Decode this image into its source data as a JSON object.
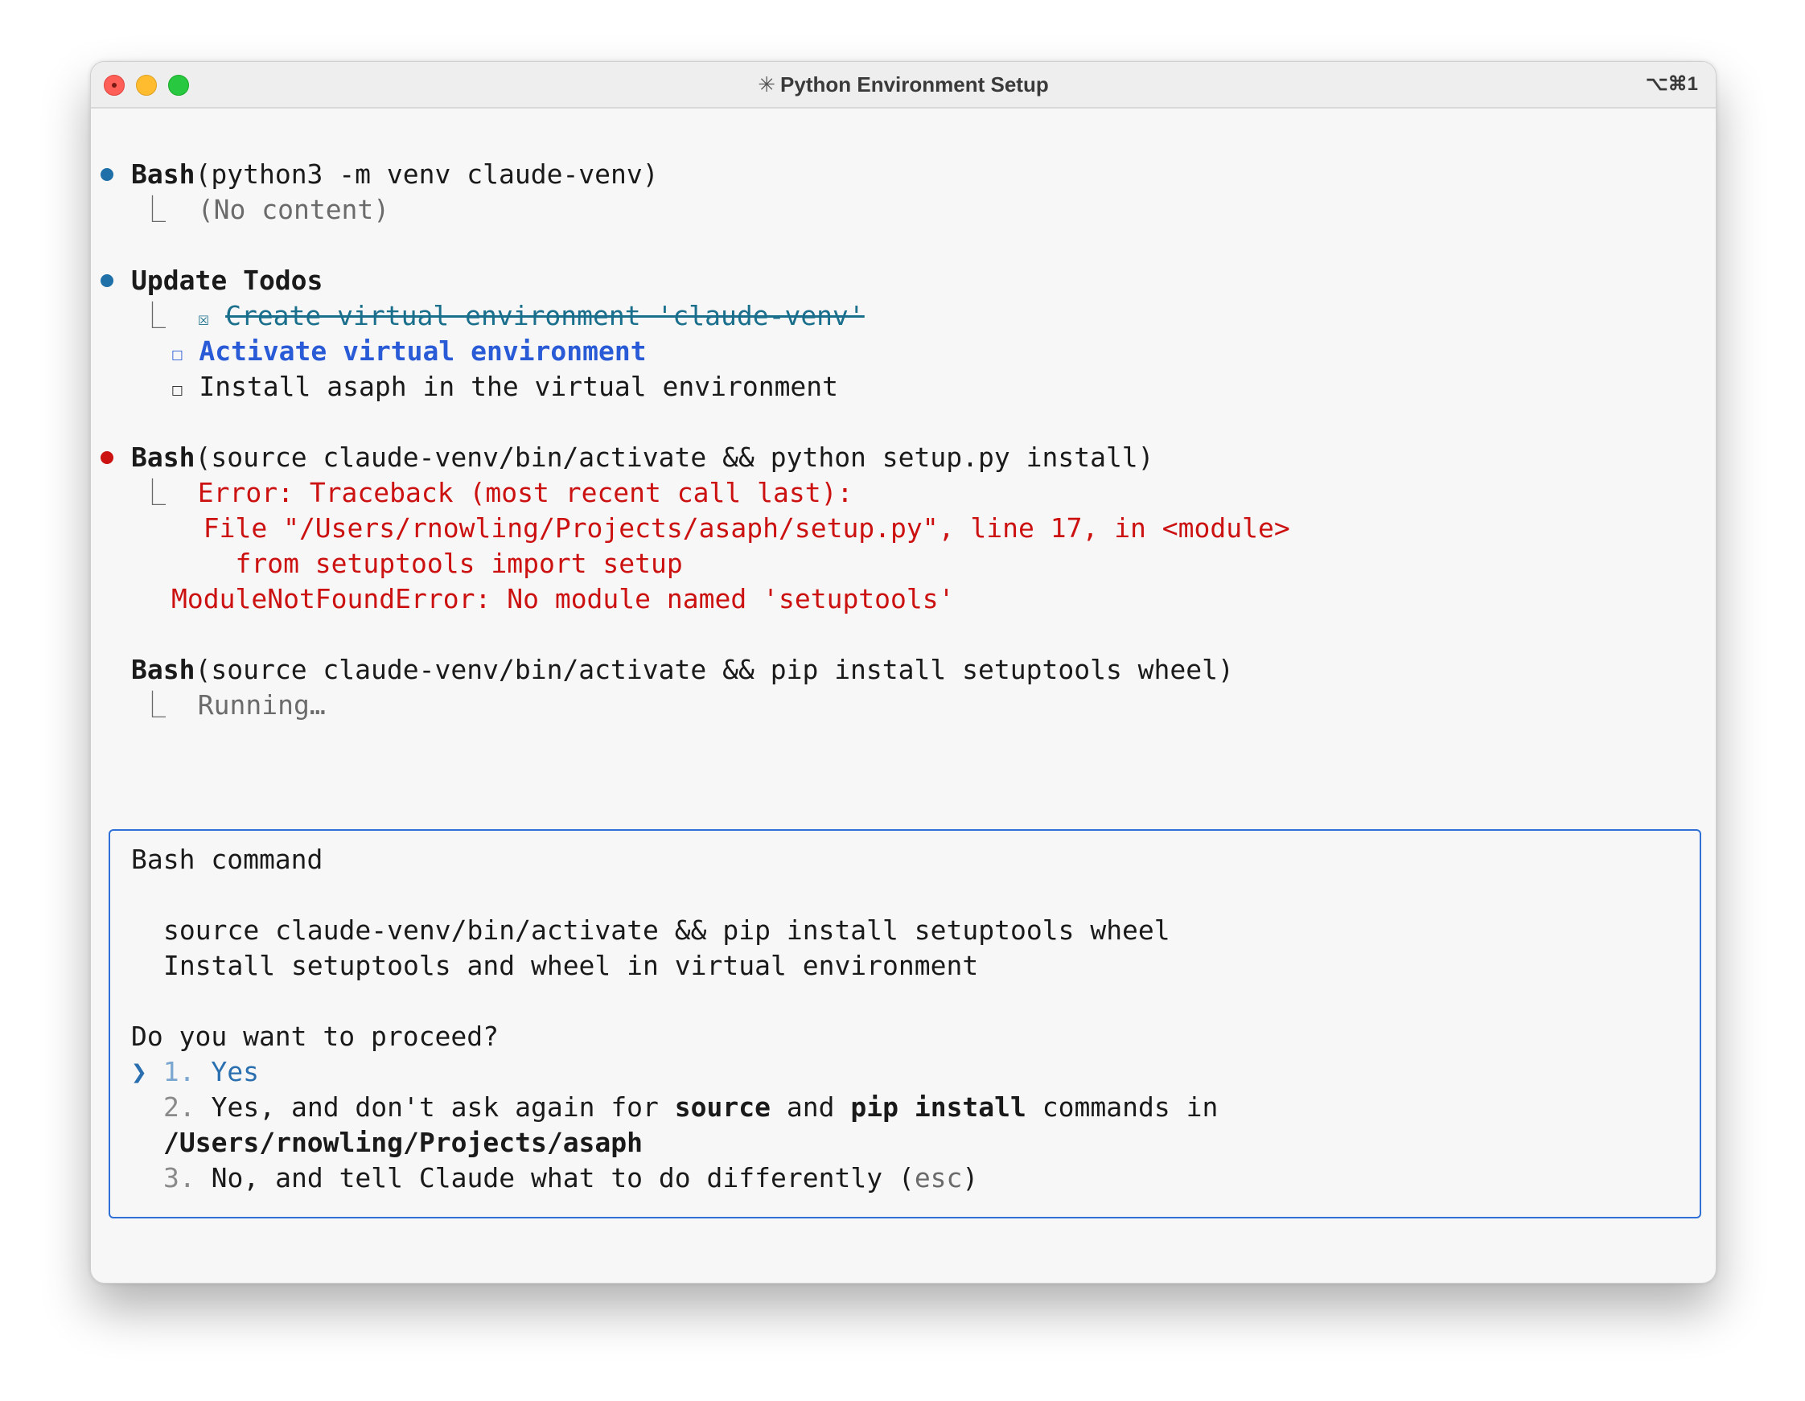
{
  "window": {
    "title_glyph": "✳",
    "title": "Python Environment Setup",
    "shortcut": "⌥⌘1"
  },
  "transcript": {
    "step1": {
      "tool": "Bash",
      "args": "(python3 -m venv claude-venv)",
      "result": "(No content)"
    },
    "todos": {
      "heading": "Update Todos",
      "items": [
        {
          "checkbox": "☒",
          "label": "Create virtual environment 'claude-venv'",
          "status": "completed"
        },
        {
          "checkbox": "☐",
          "label": "Activate virtual environment",
          "status": "in_progress"
        },
        {
          "checkbox": "☐",
          "label": "Install asaph in the virtual environment",
          "status": "pending"
        }
      ]
    },
    "step2": {
      "tool": "Bash",
      "args": "(source claude-venv/bin/activate && python setup.py install)",
      "error_lines": [
        "Error: Traceback (most recent call last):",
        "  File \"/Users/rnowling/Projects/asaph/setup.py\", line 17, in <module>",
        "    from setuptools import setup",
        "ModuleNotFoundError: No module named 'setuptools'"
      ]
    },
    "step3": {
      "tool": "Bash",
      "args": "(source claude-venv/bin/activate && pip install setuptools wheel)",
      "result": "Running…"
    },
    "tree_glyph": "⎿"
  },
  "dialog": {
    "title": "Bash command",
    "command": "source claude-venv/bin/activate && pip install setuptools wheel",
    "description": "Install setuptools and wheel in virtual environment",
    "question": "Do you want to proceed?",
    "selector": "❯",
    "options": [
      {
        "num": "1.",
        "label": "Yes"
      },
      {
        "num": "2.",
        "label_parts": [
          "Yes, and don't ask again for ",
          "source",
          " and ",
          "pip install",
          " commands in"
        ],
        "label_line2": "/Users/rnowling/Projects/asaph"
      },
      {
        "num": "3.",
        "label": "No, and tell Claude what to do differently (",
        "hint": "esc",
        "label_end": ")"
      }
    ]
  },
  "colors": {
    "accent_blue": "#2a5bd7",
    "error_red": "#cc1111",
    "dot_blue": "#1f6fa8",
    "dialog_border": "#2f6fd6"
  }
}
